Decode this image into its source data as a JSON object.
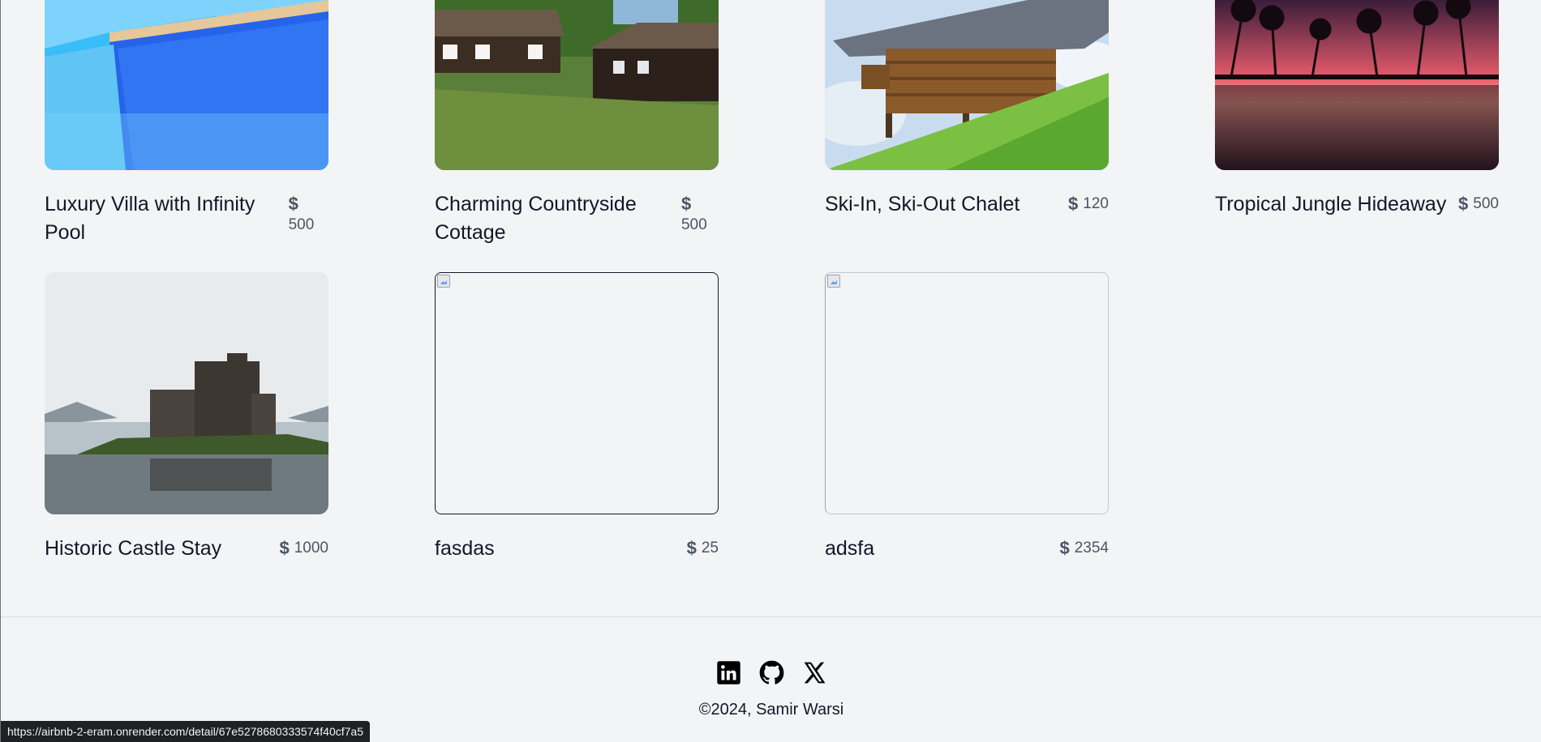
{
  "listings": [
    {
      "title": "Luxury Villa with Infinity Pool",
      "currency": "$",
      "price": "500",
      "image": "pool-photo"
    },
    {
      "title": "Charming Countryside Cottage",
      "currency": "$",
      "price": "500",
      "image": "cottage-photo"
    },
    {
      "title": "Ski-In, Ski-Out Chalet",
      "currency": "$",
      "price": "120",
      "image": "chalet-photo"
    },
    {
      "title": "Tropical Jungle Hideaway",
      "currency": "$",
      "price": "500",
      "image": "tropical-sunset-photo"
    },
    {
      "title": "Historic Castle Stay",
      "currency": "$",
      "price": "1000",
      "image": "castle-photo"
    },
    {
      "title": "fasdas",
      "currency": "$",
      "price": "25",
      "image": "broken-image"
    },
    {
      "title": "adsfa",
      "currency": "$",
      "price": "2354",
      "image": "broken-image"
    }
  ],
  "footer": {
    "socials": [
      "linkedin-icon",
      "github-icon",
      "x-icon"
    ],
    "copyright": "©2024, Samir Warsi"
  },
  "status_url": "https://airbnb-2-eram.onrender.com/detail/67e5278680333574f40cf7a5"
}
